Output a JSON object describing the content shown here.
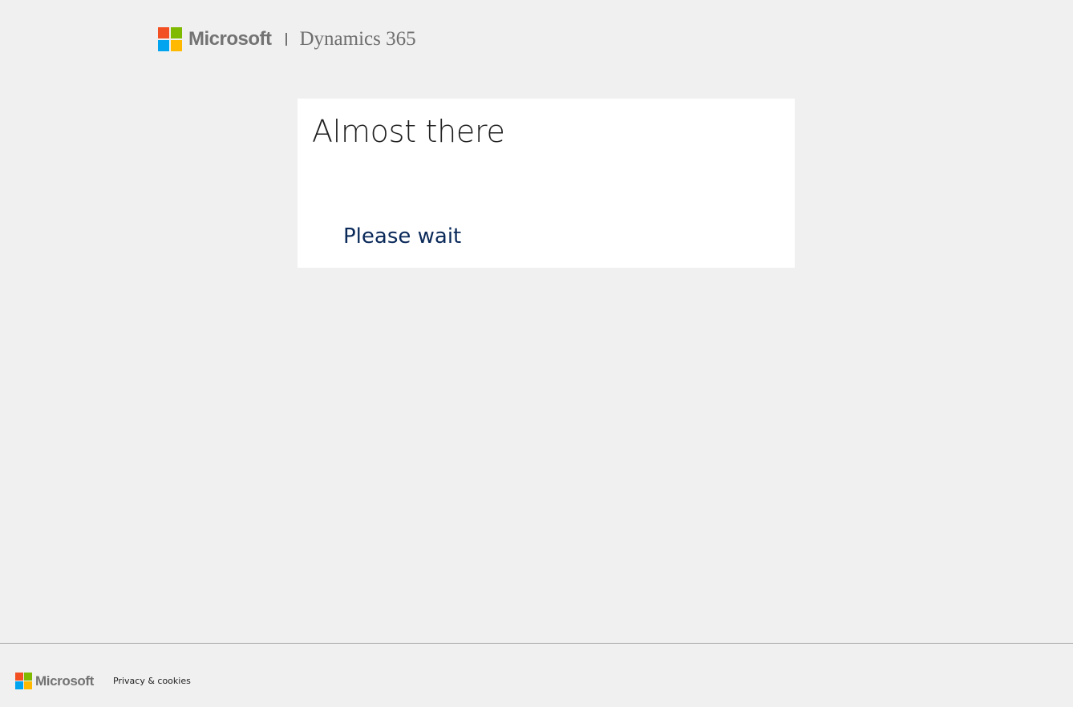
{
  "header": {
    "brand": "Microsoft",
    "product": "Dynamics 365"
  },
  "card": {
    "title": "Almost there",
    "status": "Please wait"
  },
  "footer": {
    "brand": "Microsoft",
    "privacy_link": "Privacy & cookies"
  },
  "logo_colors": {
    "red": "#f25022",
    "green": "#7fba00",
    "blue": "#00a4ef",
    "yellow": "#ffb900"
  }
}
